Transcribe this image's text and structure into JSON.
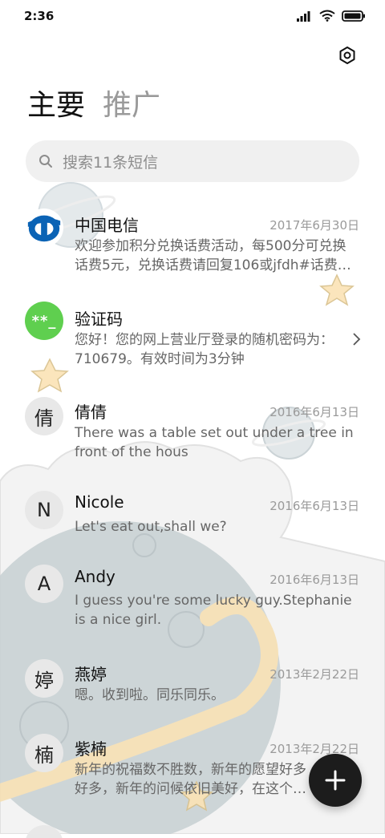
{
  "status_bar": {
    "time": "2:36"
  },
  "tabs": [
    {
      "label": "主要"
    },
    {
      "label": "推广"
    }
  ],
  "search": {
    "placeholder": "搜索11条短信"
  },
  "messages": [
    {
      "sender": "中国电信",
      "date": "2017年6月30日",
      "preview": "欢迎参加积分兑换话费活动，每500分可兑换话费5元，兑换话费请回复106或jfdh#话费…",
      "avatar": "telecom-logo"
    },
    {
      "sender": "验证码",
      "date": "",
      "preview": "您好！您的网上营业厅登录的随机密码为：710679。有效时间为3分钟",
      "avatar_text": "**_"
    },
    {
      "sender": "倩倩",
      "date": "2016年6月13日",
      "preview": "There was a table set out under a tree in front of the hous",
      "avatar_text": "倩"
    },
    {
      "sender": "Nicole",
      "date": "2016年6月13日",
      "preview": "Let's eat out,shall we?",
      "avatar_text": "N"
    },
    {
      "sender": "Andy",
      "date": "2016年6月13日",
      "preview": "I guess you're some lucky guy.Stephanie is a nice girl.",
      "avatar_text": "A"
    },
    {
      "sender": "燕婷",
      "date": "2013年2月22日",
      "preview": "嗯。收到啦。同乐同乐。",
      "avatar_text": "婷"
    },
    {
      "sender": "紫楠",
      "date": "2013年2月22日",
      "preview": "新年的祝福数不胜数，新年的愿望好多好多，新年的问候依旧美好，在这个温馨的时刻",
      "avatar_text": "楠"
    }
  ],
  "colors": {
    "accent_green": "#5fcf4f",
    "telecom_blue": "#0b63b5",
    "fab_bg": "#1c1c1c"
  },
  "fab": {
    "icon": "plus-icon"
  }
}
